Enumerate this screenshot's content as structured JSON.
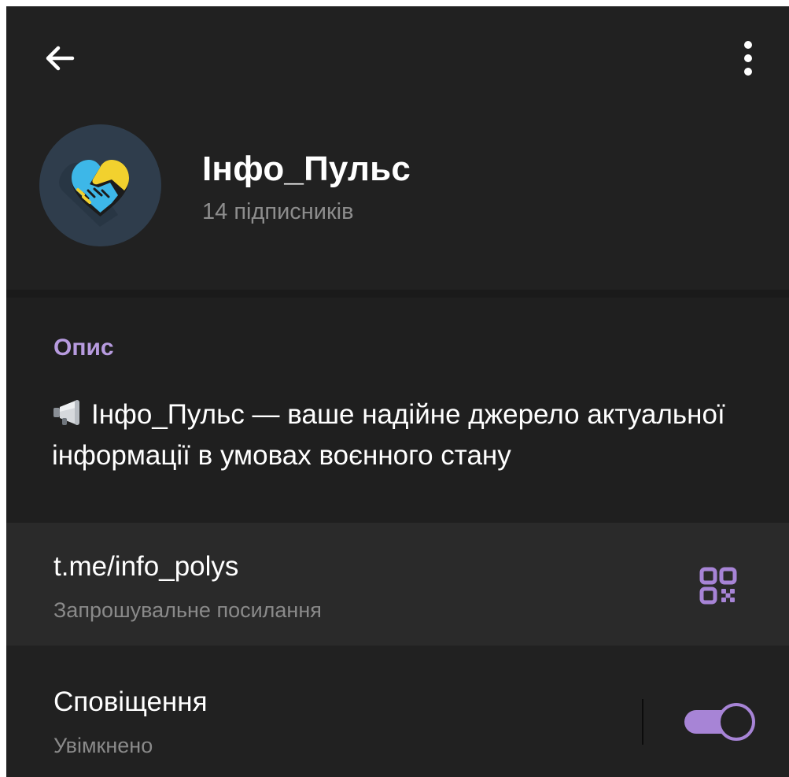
{
  "header": {
    "back_icon": "arrow-left-icon",
    "menu_icon": "more-vertical-icon"
  },
  "channel": {
    "name": "Інфо_Пульс",
    "subscribers": "14 підписників",
    "avatar_icon": "heart-handshake-icon"
  },
  "description": {
    "title": "Опис",
    "emoji_icon": "megaphone-icon",
    "text": "Інфо_Пульс — ваше надійне джерело актуальної інформації в умовах воєнного стану"
  },
  "link": {
    "url": "t.me/info_polys",
    "label": "Запрошувальне посилання",
    "qr_icon": "qr-code-icon"
  },
  "notifications": {
    "title": "Сповіщення",
    "status": "Увімкнено",
    "enabled": true
  },
  "colors": {
    "accent": "#a784d6",
    "accent_text": "#b79bdf",
    "background": "#212121",
    "row_highlight": "#2a2a2a",
    "secondary_text": "#8a8a8a"
  }
}
